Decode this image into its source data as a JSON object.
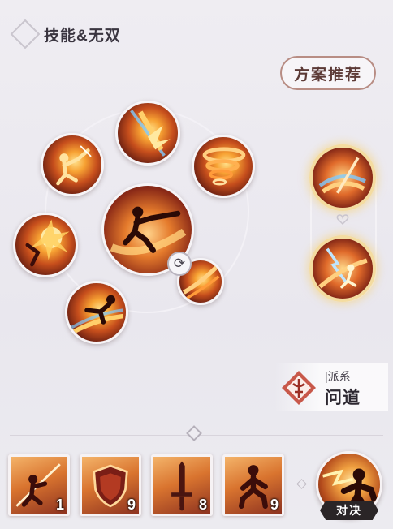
{
  "header": {
    "title": "技能&无双",
    "back_icon": "diamond-back-icon"
  },
  "plan_button": {
    "label": "方案推荐"
  },
  "skill_wheel": {
    "slots": [
      {
        "name": "skill-slot-top",
        "icon": "flame-slash-icon"
      },
      {
        "name": "skill-slot-upper-left",
        "icon": "leaping-strike-icon"
      },
      {
        "name": "skill-slot-upper-right",
        "icon": "tornado-icon"
      },
      {
        "name": "skill-slot-left",
        "icon": "burst-strike-icon"
      },
      {
        "name": "skill-slot-lower-left",
        "icon": "flying-kick-icon"
      },
      {
        "name": "skill-slot-small",
        "icon": "fire-sweep-icon"
      },
      {
        "name": "skill-slot-main",
        "icon": "blade-dash-icon"
      }
    ],
    "swap_icon": "swap-icon"
  },
  "side_skills": [
    {
      "icon": "sword-wind-icon"
    },
    {
      "icon": "lightning-leap-icon"
    }
  ],
  "sect": {
    "label": "|派系",
    "name": "问道",
    "emblem": "sect-emblem-icon"
  },
  "cards": [
    {
      "icon": "spear-warrior-icon",
      "count": "1"
    },
    {
      "icon": "shield-icon",
      "count": "9"
    },
    {
      "icon": "sword-icon",
      "count": "8"
    },
    {
      "icon": "crouch-warrior-icon",
      "count": "9"
    }
  ],
  "duel": {
    "label": "对决",
    "icon": "brawler-icon"
  },
  "colors": {
    "accent_border": "#b88d84",
    "fire": "#e57b2c",
    "dark_red": "#5a1710"
  }
}
